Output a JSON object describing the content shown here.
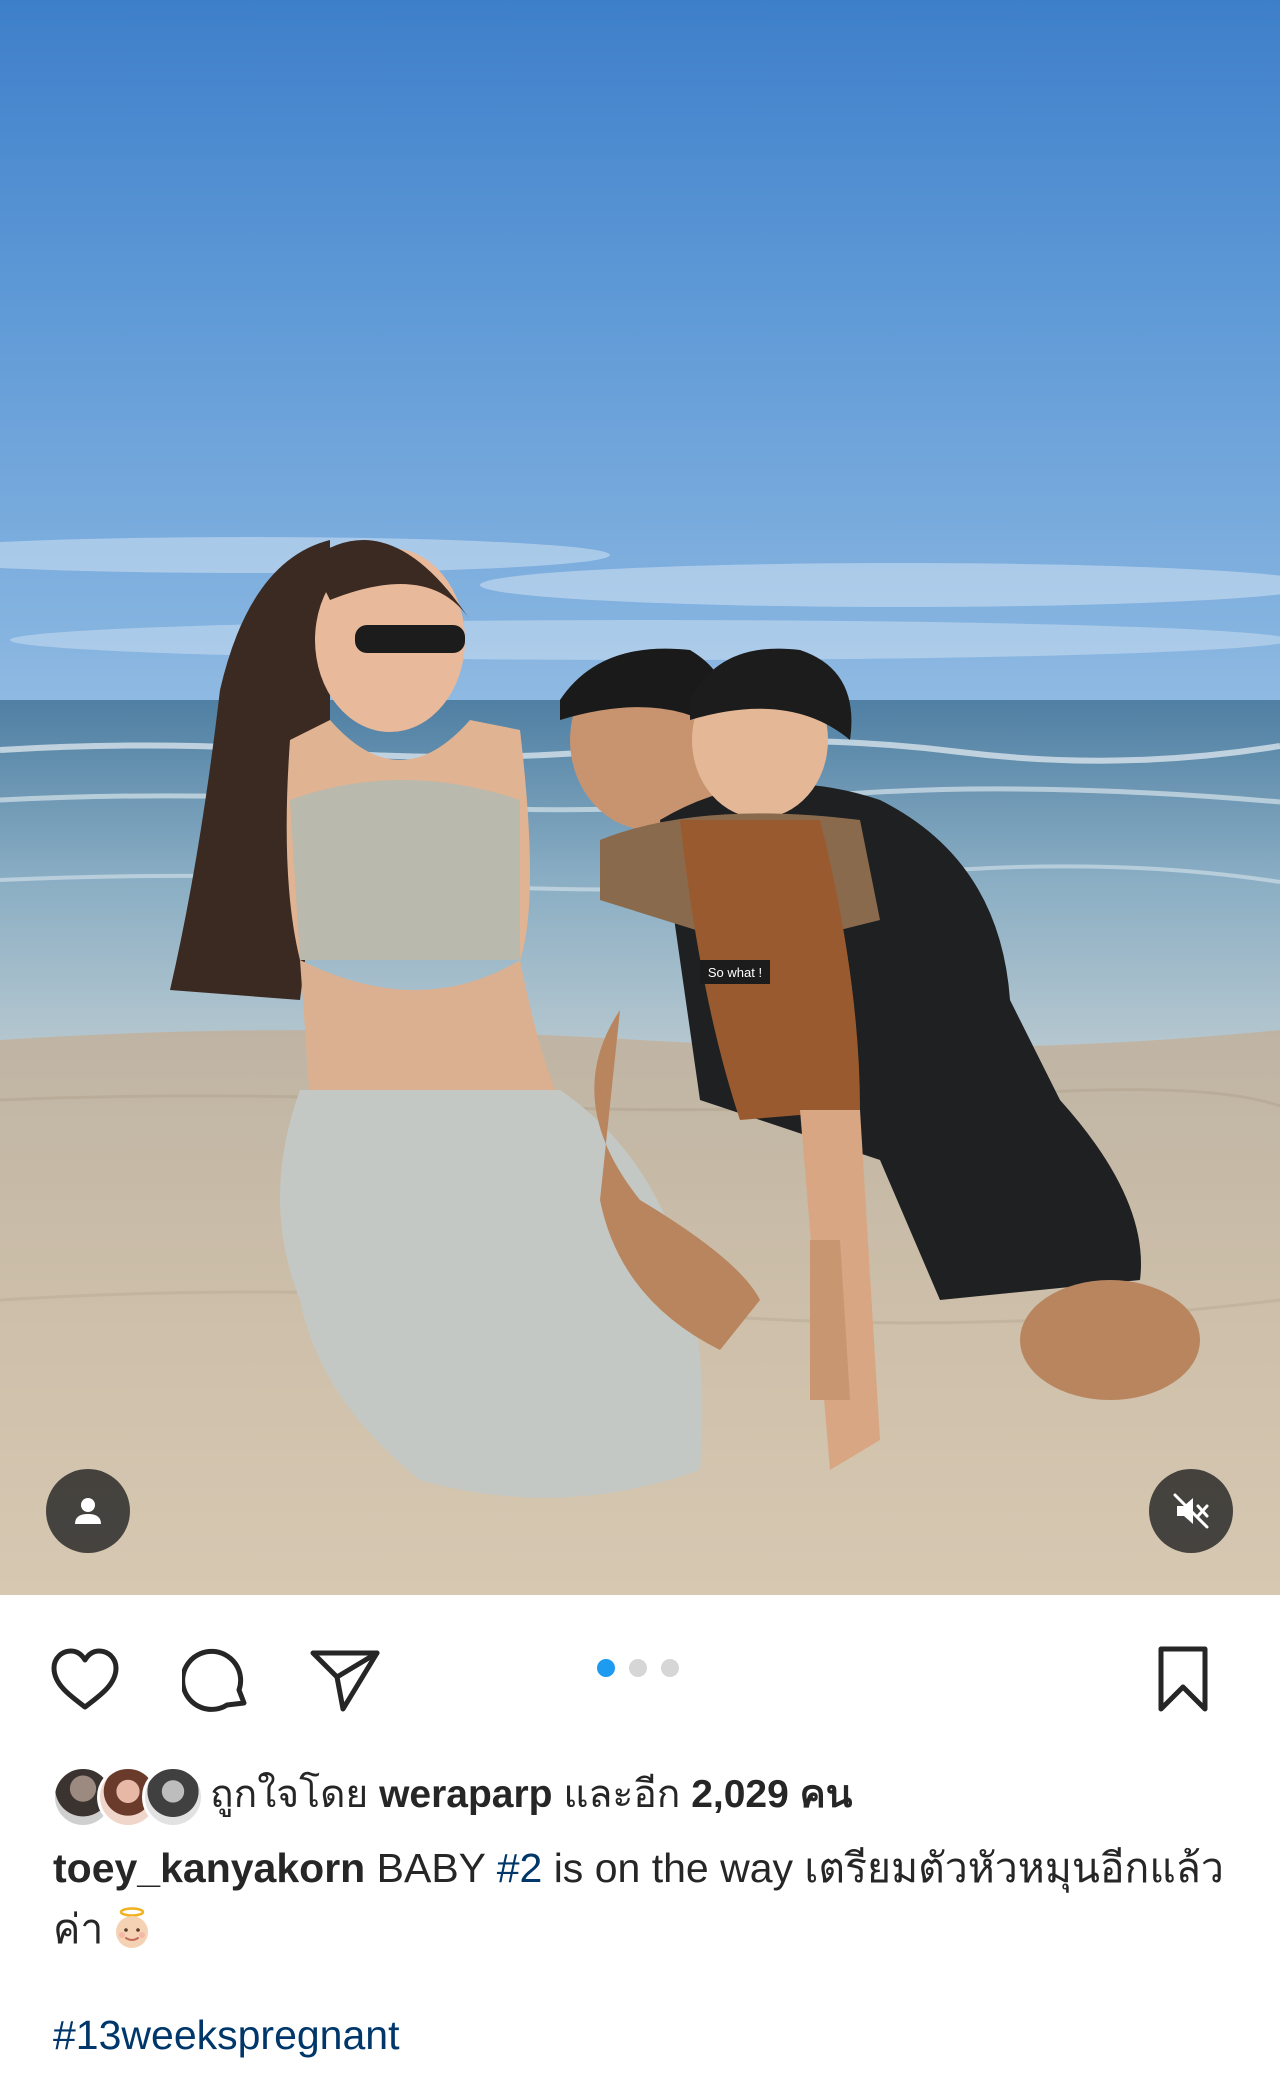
{
  "post": {
    "photo_alt": "Family photo on the beach",
    "photo_shirt_text": "So what !",
    "carousel": {
      "count": 3,
      "active_index": 0
    },
    "icons": {
      "tag": "person-tag-icon",
      "mute": "muted-speaker-icon",
      "like": "heart-icon",
      "comment": "comment-bubble-icon",
      "share": "paper-plane-icon",
      "save": "bookmark-icon"
    },
    "likes": {
      "prefix": "ถูกใจโดย",
      "user": "weraparp",
      "middle": "และอีก",
      "count": "2,029",
      "suffix": "คน"
    },
    "caption": {
      "username": "toey_kanyakorn",
      "text_before_tag": "BABY",
      "inline_tag": "#2",
      "text_after_tag": "is on the way เตรียมตัวหัวหมุนอีกแล้วค่า",
      "emoji": "baby-angel-emoji",
      "hashtag": "#13weekspregnant"
    },
    "colors": {
      "text": "#262626",
      "link": "#00376b",
      "dot_active": "#1d9bf0",
      "dot_inactive": "#d6d6d6"
    }
  }
}
